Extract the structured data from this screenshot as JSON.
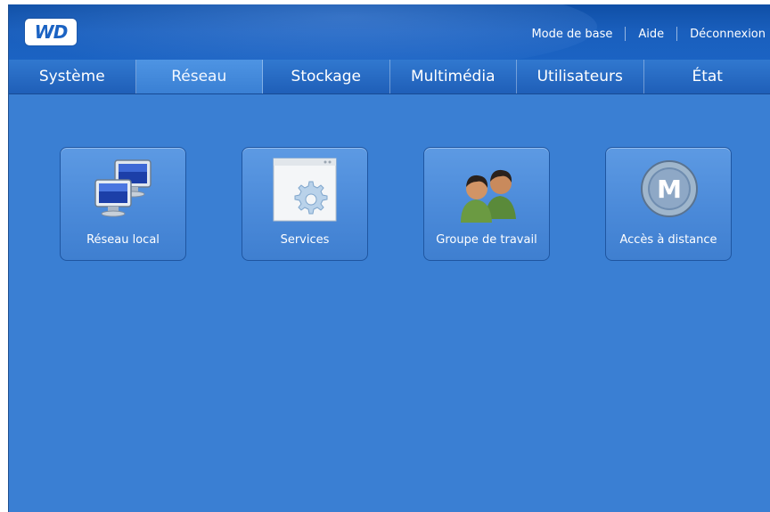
{
  "header": {
    "logo_text": "WD",
    "links": [
      {
        "label": "Mode de base"
      },
      {
        "label": "Aide"
      },
      {
        "label": "Déconnexion"
      }
    ]
  },
  "tabs": [
    {
      "label": "Système",
      "active": false
    },
    {
      "label": "Réseau",
      "active": true
    },
    {
      "label": "Stockage",
      "active": false
    },
    {
      "label": "Multimédia",
      "active": false
    },
    {
      "label": "Utilisateurs",
      "active": false
    },
    {
      "label": "État",
      "active": false
    }
  ],
  "tiles": [
    {
      "label": "Réseau local",
      "icon": "network-computers-icon"
    },
    {
      "label": "Services",
      "icon": "services-gear-window-icon"
    },
    {
      "label": "Groupe de travail",
      "icon": "workgroup-users-icon"
    },
    {
      "label": "Accès à distance",
      "icon": "remote-access-m-icon"
    }
  ],
  "colors": {
    "background": "#3a7fd3",
    "header": "#1b63c3",
    "active_tab": "#4e94e3",
    "tile": "#4b8ad9"
  }
}
